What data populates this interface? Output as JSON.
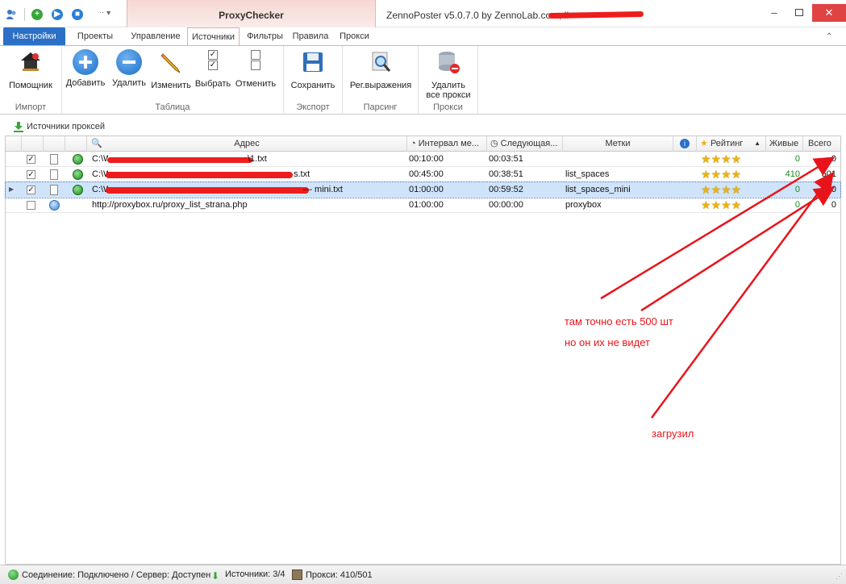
{
  "titlebar": {
    "context_tab": "ProxyChecker",
    "window_title": "ZennoPoster v5.0.7.0 by ZennoLab.com, li"
  },
  "ribbon_tabs": [
    {
      "label": "Настройки"
    },
    {
      "label": "Проекты"
    },
    {
      "label": "Управление"
    },
    {
      "label": "Источники"
    },
    {
      "label": "Фильтры"
    },
    {
      "label": "Правила"
    },
    {
      "label": "Прокси"
    }
  ],
  "ribbon": {
    "groups": {
      "import": "Импорт",
      "table": "Таблица",
      "export": "Экспорт",
      "parsing": "Парсинг",
      "proxies": "Прокси"
    },
    "buttons": {
      "helper": "Помощник",
      "add": "Добавить",
      "delete": "Удалить",
      "edit": "Изменить",
      "select": "Выбрать",
      "cancel": "Отменить",
      "save": "Сохранить",
      "regex": "Рег.выражения",
      "delete_all_line1": "Удалить",
      "delete_all_line2": "все прокси"
    }
  },
  "panel": {
    "title": "Источники проксей"
  },
  "grid": {
    "columns": {
      "address": "Адрес",
      "interval": "Интервал ме...",
      "next": "Следующая...",
      "tags": "Метки",
      "rating": "Рейтинг",
      "alive": "Живые",
      "total": "Всего"
    },
    "rows": [
      {
        "checked": "✓",
        "address": "C:\\W",
        "address_tail": "\\1.txt",
        "interval": "00:10:00",
        "next": "00:03:51",
        "tags": "",
        "stars": "★★★★",
        "alive": "0",
        "total": "0"
      },
      {
        "checked": "✓",
        "address": "C:\\W",
        "address_tail": "s.txt",
        "interval": "00:45:00",
        "next": "00:38:51",
        "tags": "list_spaces",
        "stars": "★★★★",
        "alive": "410",
        "total": "501"
      },
      {
        "checked": "✓",
        "address": "C:\\W",
        "address_tail": "— mini.txt",
        "interval": "01:00:00",
        "next": "00:59:52",
        "tags": "list_spaces_mini",
        "stars": "★★★★",
        "alive": "0",
        "total": "0"
      },
      {
        "checked": "",
        "address": "http://proxybox.ru/proxy_list_strana.php",
        "address_tail": "",
        "interval": "01:00:00",
        "next": "00:00:00",
        "tags": "proxybox",
        "stars": "★★★★",
        "alive": "0",
        "total": "0"
      }
    ]
  },
  "annotations": {
    "line1": "там точно есть 500 шт",
    "line2": "но он их не видет",
    "line3": "загрузил"
  },
  "statusbar": {
    "connection": "Соединение: Подключено / Сервер: Доступен",
    "sources": "Источники: 3/4",
    "proxies": "Прокси: 410/501"
  }
}
